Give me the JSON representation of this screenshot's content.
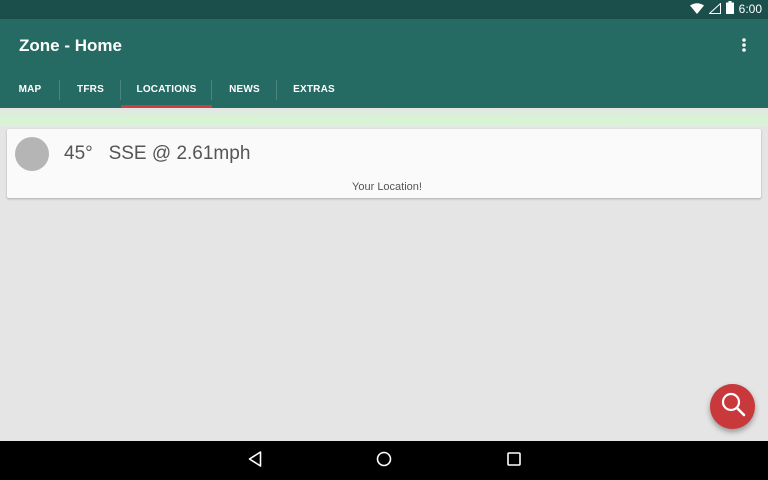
{
  "status_bar": {
    "time": "6:00",
    "icons": [
      "wifi-icon",
      "cellular-signal-icon",
      "battery-icon"
    ]
  },
  "app_bar": {
    "title": "Zone - Home",
    "menu_icon": "more-vert-icon",
    "background_color": "#256a63"
  },
  "tabs": [
    {
      "label": "MAP",
      "active": false
    },
    {
      "label": "TFRS",
      "active": false
    },
    {
      "label": "LOCATIONS",
      "active": true
    },
    {
      "label": "NEWS",
      "active": false
    },
    {
      "label": "EXTRAS",
      "active": false
    }
  ],
  "tab_indicator_color": "#c8403f",
  "location_card": {
    "bearing": "45°",
    "wind": "SSE @ 2.61mph",
    "subtitle": "Your Location!"
  },
  "fab": {
    "icon": "search-icon",
    "color": "#c9383b"
  },
  "nav_bar": {
    "buttons": [
      "back-icon",
      "home-icon",
      "recents-icon"
    ]
  }
}
